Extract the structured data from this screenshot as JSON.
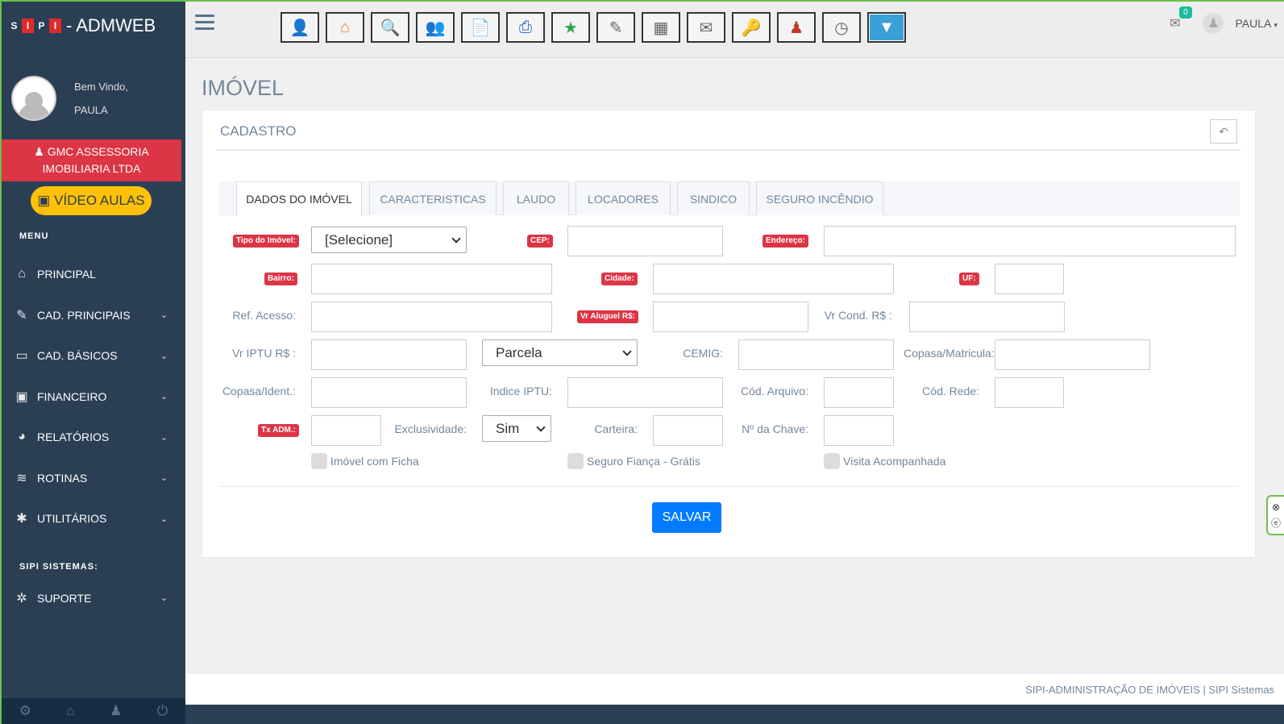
{
  "brand": {
    "logo_letters": [
      "S",
      "I",
      "P",
      "I"
    ],
    "title": "- ADMWEB"
  },
  "profile": {
    "welcome": "Bem Vindo,",
    "user": "PAULA"
  },
  "company": "GMC ASSESSORIA IMOBILIARIA LTDA",
  "video_label": "VÍDEO AULAS",
  "menu_title": "MENU",
  "menu": [
    {
      "label": "PRINCIPAL",
      "icon": "home-icon",
      "glyph": "⌂",
      "chevron": false
    },
    {
      "label": "CAD. PRINCIPAIS",
      "icon": "edit-icon",
      "glyph": "✎",
      "chevron": true
    },
    {
      "label": "CAD. BÁSICOS",
      "icon": "folder-icon",
      "glyph": "▭",
      "chevron": true
    },
    {
      "label": "FINANCEIRO",
      "icon": "money-icon",
      "glyph": "▣",
      "chevron": true
    },
    {
      "label": "RELATÓRIOS",
      "icon": "pie-chart-icon",
      "glyph": "◕",
      "chevron": true
    },
    {
      "label": "ROTINAS",
      "icon": "database-icon",
      "glyph": "≋",
      "chevron": true
    },
    {
      "label": "UTILITÁRIOS",
      "icon": "gear-icon",
      "glyph": "✱",
      "chevron": true
    }
  ],
  "sipi_title": "SIPI SISTEMAS:",
  "support": {
    "label": "SUPORTE",
    "icon": "bug-icon",
    "glyph": "✲"
  },
  "user_name": "PAULA",
  "mail_count": "0",
  "page_title": "IMÓVEL",
  "panel_title": "CADASTRO",
  "tabs": [
    "DADOS DO IMÓVEL",
    "CARACTERISTICAS",
    "LAUDO",
    "LOCADORES",
    "SINDICO",
    "SEGURO INCÊNDIO"
  ],
  "form": {
    "tipo_label": "Tipo do Imóvel:",
    "tipo_value": "[Selecione]",
    "cep_label": "CEP:",
    "endereco_label": "Endereço:",
    "bairro_label": "Bairro:",
    "cidade_label": "Cidade:",
    "uf_label": "UF:",
    "ref_label": "Ref. Acesso:",
    "aluguel_label": "Vr Aluguel R$:",
    "cond_label": "Vr Cond. R$ :",
    "iptu_label": "Vr IPTU R$ :",
    "parcela_value": "Parcela",
    "cemig_label": "CEMIG:",
    "copasa_mat_label": "Copasa/Matricula:",
    "copasa_ident_label": "Copasa/Ident.:",
    "indice_label": "Indice IPTU:",
    "cod_arquivo_label": "Cód. Arquivo:",
    "cod_rede_label": "Cód. Rede:",
    "tx_adm_label": "Tx ADM.:",
    "exclusividade_label": "Exclusividade:",
    "exclusividade_value": "Sim",
    "carteira_label": "Carteira:",
    "chave_label": "Nº da Chave:",
    "chk_ficha": "Imóvel com Ficha",
    "chk_seguro": "Seguro Fiança - Grátis",
    "chk_visita": "Visita Acompanhada"
  },
  "save_label": "SALVAR",
  "footer": "SIPI-ADMINISTRAÇÃO DE IMÓVEIS | SIPI Sistemas"
}
